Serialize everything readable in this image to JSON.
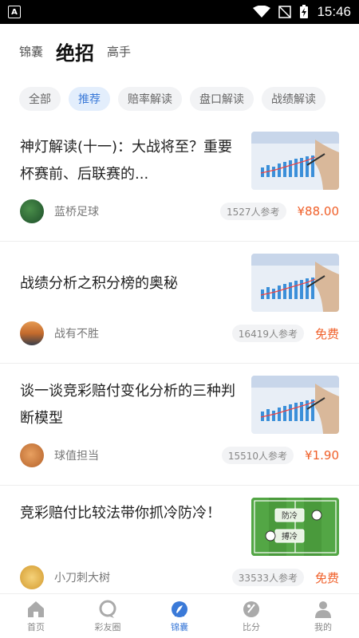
{
  "status": {
    "time": "15:46",
    "left_icon": "A"
  },
  "header": {
    "tabs": [
      "锦囊",
      "绝招",
      "高手"
    ]
  },
  "filters": [
    "全部",
    "推荐",
    "赔率解读",
    "盘口解读",
    "战绩解读"
  ],
  "articles": [
    {
      "title": "神灯解读(十一)：大战将至？重要杯赛前、后联赛的...",
      "author": "蓝桥足球",
      "views": "1527人参考",
      "price": "¥88.00",
      "thumb": "chart"
    },
    {
      "title": "战绩分析之积分榜的奥秘",
      "author": "战有不胜",
      "views": "16419人参考",
      "price": "免费",
      "thumb": "chart"
    },
    {
      "title": "谈一谈竞彩赔付变化分析的三种判断模型",
      "author": "球值担当",
      "views": "15510人参考",
      "price": "¥1.90",
      "thumb": "chart"
    },
    {
      "title": "竞彩赔付比较法带你抓冷防冷！",
      "author": "小刀刺大树",
      "views": "33533人参考",
      "price": "免费",
      "thumb": "field",
      "field_labels": [
        "防冷",
        "搏冷"
      ]
    }
  ],
  "tabbar": {
    "items": [
      "首页",
      "彩友圈",
      "锦囊",
      "比分",
      "我的"
    ]
  },
  "colors": {
    "accent": "#3b7ad8",
    "price": "#f0602a"
  }
}
